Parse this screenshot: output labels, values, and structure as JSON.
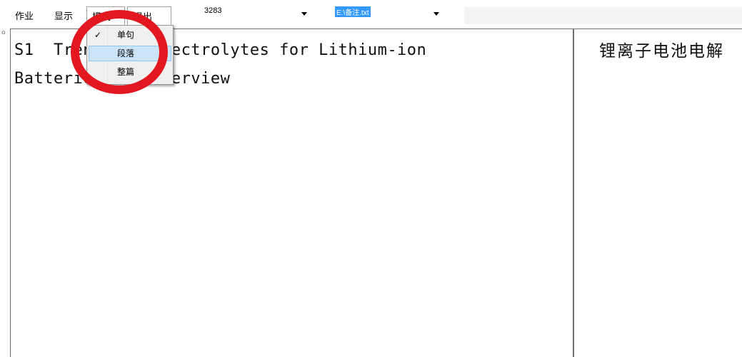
{
  "menubar": {
    "items": [
      "作业",
      "显示",
      "模式",
      "退出"
    ]
  },
  "combo1": {
    "value": "3283"
  },
  "combo2": {
    "value": "E:\\备注.txt"
  },
  "dropdown": {
    "items": [
      {
        "label": "单句",
        "checked": true
      },
      {
        "label": "段落",
        "checked": false
      },
      {
        "label": "整篇",
        "checked": false
      }
    ],
    "check_glyph": "✓"
  },
  "left_pane": {
    "text": "S1  Trends in Electrolytes for Lithium-ion\nBatteries: An Overview"
  },
  "right_pane": {
    "text": "锂离子电池电解"
  },
  "marker": "⊙",
  "colors": {
    "annotation_circle": "#e3171f",
    "highlight": "#cce4f7",
    "selection": "#3399ff"
  }
}
